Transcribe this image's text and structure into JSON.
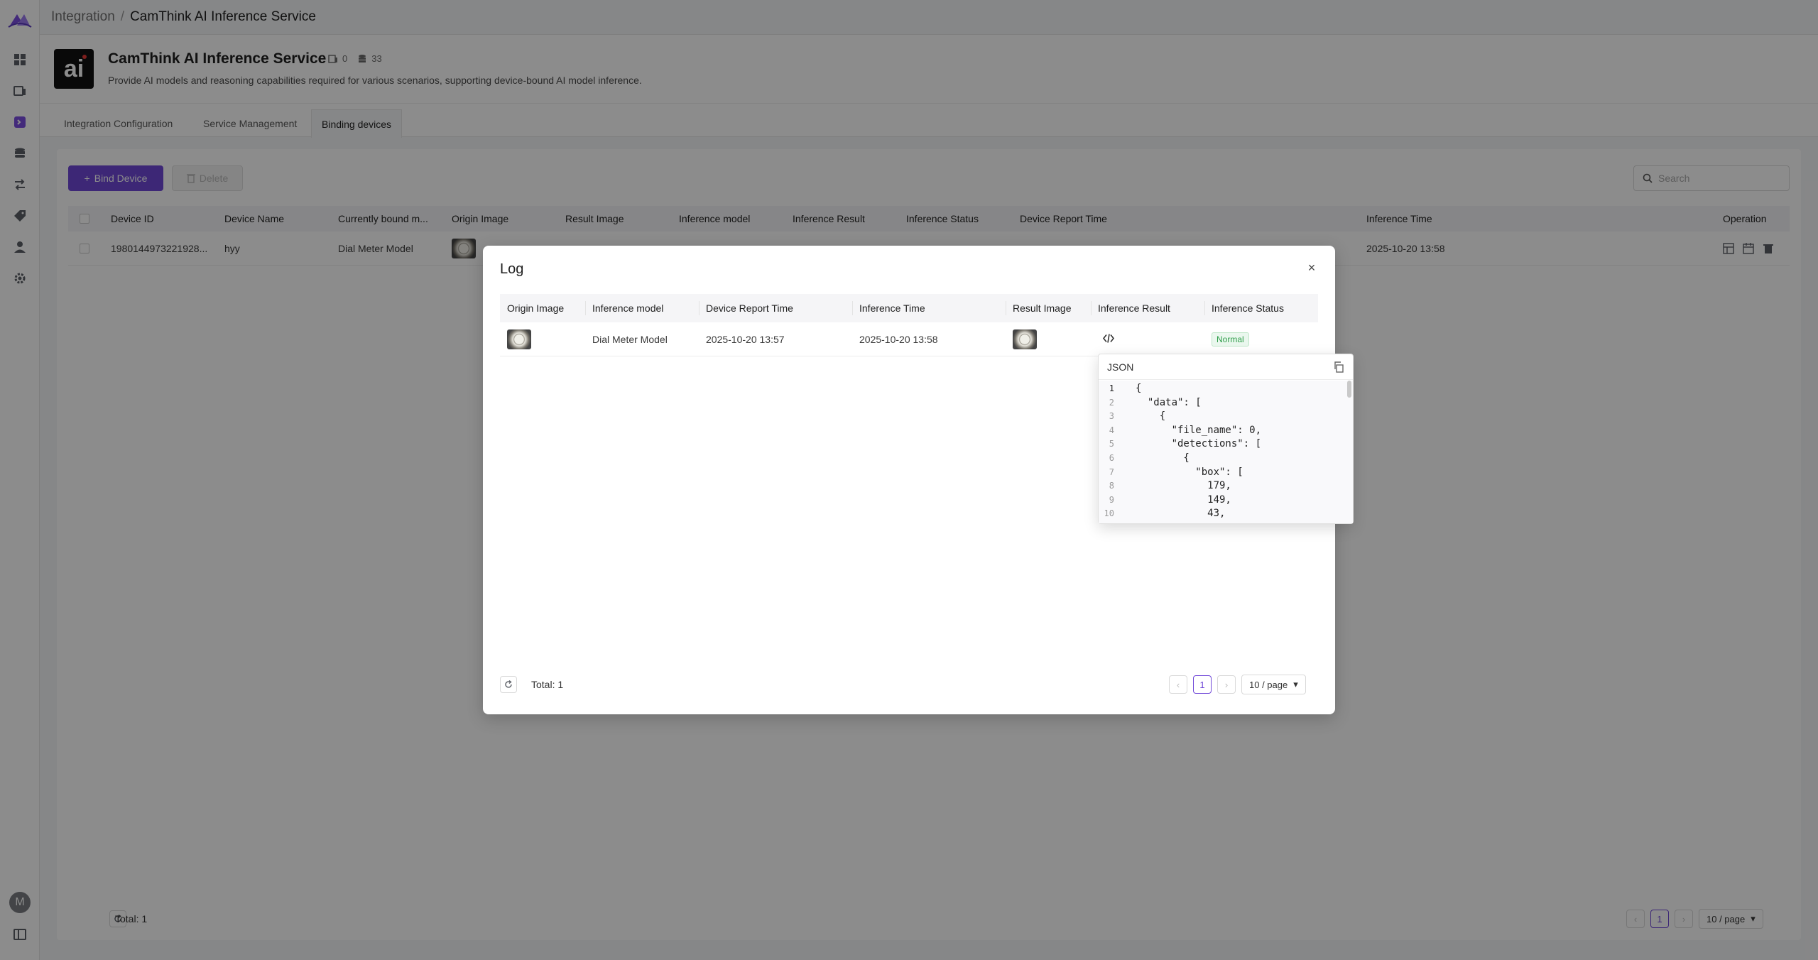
{
  "breadcrumb": {
    "root": "Integration",
    "separator": "/",
    "current": "CamThink AI Inference Service"
  },
  "app": {
    "logo_text": "ai",
    "title": "CamThink AI Inference Service",
    "stat_devices": "0",
    "stat_entities": "33",
    "description": "Provide AI models and reasoning capabilities required for various scenarios, supporting device-bound AI model inference."
  },
  "tabs": [
    {
      "label": "Integration Configuration"
    },
    {
      "label": "Service Management"
    },
    {
      "label": "Binding devices"
    }
  ],
  "toolbar": {
    "bind_label": "Bind Device",
    "delete_label": "Delete",
    "search_placeholder": "Search"
  },
  "table": {
    "headers": [
      "Device ID",
      "Device Name",
      "Currently bound m...",
      "Origin Image",
      "Result Image",
      "Inference model",
      "Inference Result",
      "Inference Status",
      "Device Report Time",
      "Inference Time",
      "Operation"
    ],
    "rows": [
      {
        "device_id": "1980144973221928...",
        "device_name": "hyy",
        "bound_model": "Dial Meter Model",
        "inference_time": "2025-10-20 13:58"
      }
    ],
    "total": "Total: 1",
    "page": "1",
    "page_size": "10 / page"
  },
  "modal": {
    "title": "Log",
    "close": "×",
    "headers": [
      "Origin Image",
      "Inference model",
      "Device Report Time",
      "Inference Time",
      "Result Image",
      "Inference Result",
      "Inference Status"
    ],
    "row": {
      "model": "Dial Meter Model",
      "report_time": "2025-10-20 13:57",
      "inference_time": "2025-10-20 13:58",
      "status": "Normal"
    },
    "total": "Total: 1",
    "page": "1",
    "page_size": "10 / page"
  },
  "json_popover": {
    "title": "JSON",
    "lines": [
      {
        "num": "1",
        "text": "{"
      },
      {
        "num": "2",
        "text": "  \"data\": ["
      },
      {
        "num": "3",
        "text": "    {"
      },
      {
        "num": "4",
        "text": "      \"file_name\": 0,"
      },
      {
        "num": "5",
        "text": "      \"detections\": ["
      },
      {
        "num": "6",
        "text": "        {"
      },
      {
        "num": "7",
        "text": "          \"box\": ["
      },
      {
        "num": "8",
        "text": "            179,"
      },
      {
        "num": "9",
        "text": "            149,"
      },
      {
        "num": "10",
        "text": "            43,"
      }
    ]
  },
  "colors": {
    "accent": "#6f47d8",
    "status_normal": "#2f9e4a"
  }
}
